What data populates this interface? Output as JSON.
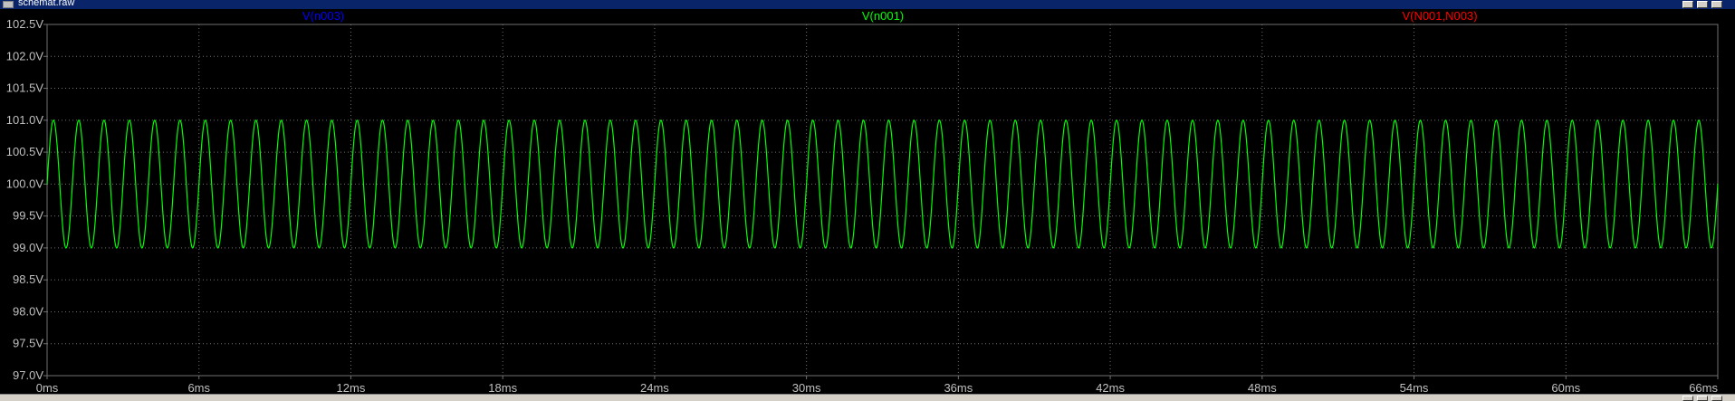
{
  "window": {
    "title": "schemat.raw",
    "buttons": [
      "minimize",
      "restore",
      "close"
    ]
  },
  "colors": {
    "background": "#000000",
    "grid": "#707070",
    "axis_text": "#c0c0c0",
    "trace_n003": "#0000ff",
    "trace_n001": "#00ff00",
    "trace_n001_n003": "#ff0000"
  },
  "chart_data": {
    "type": "line",
    "title": "",
    "xlabel": "",
    "ylabel": "",
    "xlim": [
      0,
      66
    ],
    "ylim": [
      97.0,
      102.5
    ],
    "x_unit": "ms",
    "y_unit": "V",
    "x_ticks": [
      "0ms",
      "6ms",
      "12ms",
      "18ms",
      "24ms",
      "30ms",
      "36ms",
      "42ms",
      "48ms",
      "54ms",
      "60ms",
      "66ms"
    ],
    "y_ticks": [
      "102.5V",
      "102.0V",
      "101.5V",
      "101.0V",
      "100.5V",
      "100.0V",
      "99.5V",
      "99.0V",
      "98.5V",
      "98.0V",
      "97.5V",
      "97.0V"
    ],
    "grid": true,
    "legend": "top",
    "series": [
      {
        "name": "V(n003)",
        "color": "#0000ff",
        "values": []
      },
      {
        "name": "V(n001)",
        "color": "#00ff00",
        "waveform": "sine",
        "offset": 100.0,
        "amplitude": 1.0,
        "frequency_hz": 1000,
        "x_start": 0,
        "x_end": 66
      },
      {
        "name": "V(N001,N003)",
        "color": "#ff0000",
        "values": []
      }
    ]
  }
}
